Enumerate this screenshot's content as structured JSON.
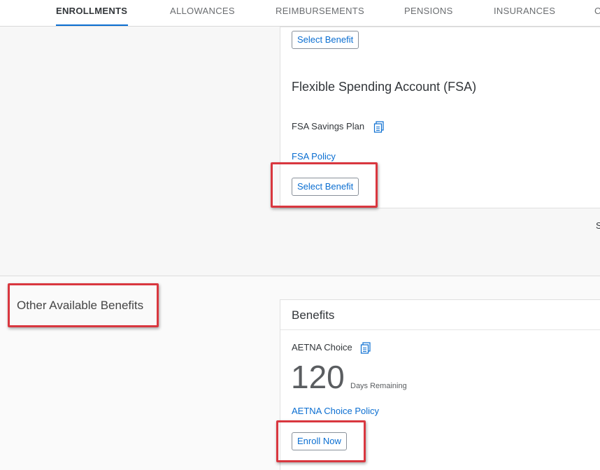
{
  "tabs": [
    {
      "label": "ENROLLMENTS",
      "active": true
    },
    {
      "label": "ALLOWANCES",
      "active": false
    },
    {
      "label": "REIMBURSEMENTS",
      "active": false
    },
    {
      "label": "PENSIONS",
      "active": false
    },
    {
      "label": "INSURANCES",
      "active": false
    },
    {
      "label": "C",
      "active": false
    }
  ],
  "top_card": {
    "select_button": "Select Benefit"
  },
  "fsa": {
    "title": "Flexible Spending Account (FSA)",
    "plan_name": "FSA Savings Plan",
    "plan_icon": "document-icon",
    "policy_link": "FSA Policy",
    "select_button": "Select Benefit"
  },
  "edge_text": "S",
  "other_benefits": {
    "section_title": "Other Available Benefits",
    "card_title": "Benefits",
    "plan_name": "AETNA Choice",
    "plan_icon": "document-icon",
    "days_value": "120",
    "days_label": "Days Remaining",
    "policy_link": "AETNA Choice Policy",
    "enroll_button": "Enroll Now"
  },
  "colors": {
    "accent": "#0a6ed1",
    "highlight": "#d9373f"
  }
}
